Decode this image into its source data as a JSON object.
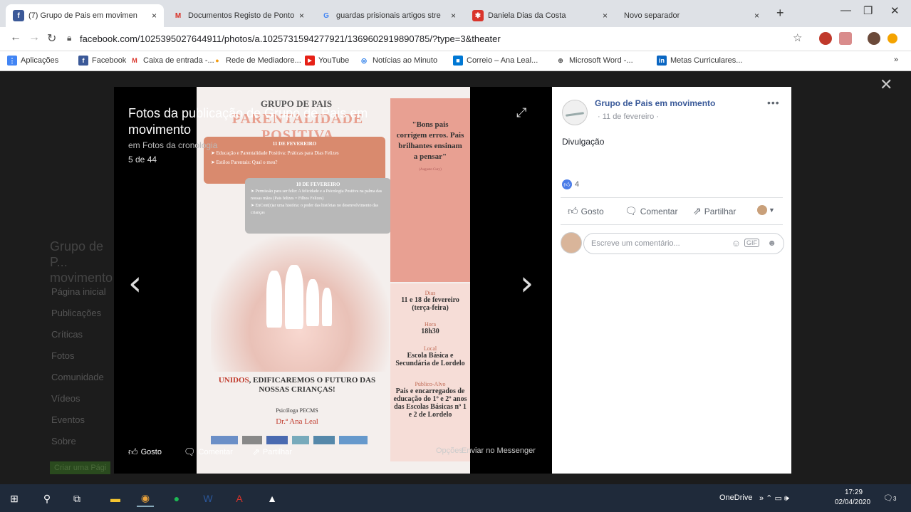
{
  "tabs": [
    {
      "label": "(7) Grupo de Pais em movimen",
      "icon": "facebook-icon",
      "color": "#3b5998",
      "glyph": "f"
    },
    {
      "label": "Documentos Registo de Ponto",
      "icon": "gmail-icon",
      "color": "#d93025",
      "glyph": "M"
    },
    {
      "label": "guardas prisionais artigos stre",
      "icon": "google-icon",
      "color": "#4285f4",
      "glyph": "G"
    },
    {
      "label": "Daniela Dias da Costa",
      "icon": "pdf-icon",
      "color": "#d9342b",
      "glyph": "✱"
    },
    {
      "label": "Novo separador",
      "icon": "",
      "color": "",
      "glyph": ""
    }
  ],
  "close_glyph": "×",
  "url": "facebook.com/1025395027644911/photos/a.1025731594277921/1369602919890785/?type=3&theater",
  "bookmarks": [
    {
      "label": "Aplicações",
      "color": "#4285f4",
      "glyph": "⋮"
    },
    {
      "label": "Facebook",
      "color": "#3b5998",
      "glyph": "f"
    },
    {
      "label": "Caixa de entrada -...",
      "color": "#d93025",
      "glyph": "M"
    },
    {
      "label": "Rede de Mediadore...",
      "color": "#f39c12",
      "glyph": "●"
    },
    {
      "label": "YouTube",
      "color": "#e62117",
      "glyph": "▶"
    },
    {
      "label": "Notícias ao Minuto",
      "color": "#1a73e8",
      "glyph": "◎"
    },
    {
      "label": "Correio – Ana Leal...",
      "color": "#0078d4",
      "glyph": "■"
    },
    {
      "label": "Microsoft Word -...",
      "color": "#555555",
      "glyph": "⊕"
    },
    {
      "label": "Metas Curriculares...",
      "color": "#0a66c2",
      "glyph": "in"
    }
  ],
  "bookmarks_more": "»",
  "background": {
    "left_title": "Grupo de P... movimento",
    "left_items": [
      "Página inicial",
      "Publicações",
      "Críticas",
      "Fotos",
      "Comunidade",
      "Vídeos",
      "Eventos",
      "Sobre"
    ],
    "left_button": "Criar uma Pági"
  },
  "viewer": {
    "title": "Fotos da publicação de Grupo de Pais em movimento",
    "subtitle": "em Fotos da cronologia",
    "count": "5 de 44",
    "like": "Gosto",
    "comment": "Comentar",
    "share": "Partilhar",
    "options": "Opções",
    "messenger": "Enviar no Messenger"
  },
  "poster": {
    "title": "GRUPO DE PAIS",
    "title2": "PARENTALIDADE POSITIVA",
    "box1_date": "11 DE FEVEREIRO",
    "box1_items": [
      "➤ Educação e Parentalidade Positiva: Práticas para Dias Felizes",
      "➤ Estilos Parentais: Qual o meu?"
    ],
    "box2_date": "18 DE FEVEREIRO",
    "box2_items": [
      "➤ Permissão para ser feliz: A felicidade e a Psicologia Positiva na palma das nossas mãos (Pais felizes = Filhos Felizes)",
      "➤ EnCont(r)ar uma história: o poder das histórias no desenvolvimento das crianças"
    ],
    "quote": "\"Bons pais corrigem erros. Pais brilhantes ensinam a pensar\"",
    "quote_author": "(Augusto Cury)",
    "dias_h": "Dias",
    "dias": "11 e 18 de fevereiro (terça-feira)",
    "hora_h": "Hora",
    "hora": "18h30",
    "local_h": "Local",
    "local": "Escola Básica e Secundária de Lordelo",
    "publico_h": "Público-Alvo",
    "publico": "Pais e encarregados de educação do 1º e 2º anos das Escolas Básicas nº 1 e 2 de Lordelo",
    "slogan_u": "UNIDOS",
    "slogan": ", EDIFICAREMOS O FUTURO DAS NOSSAS CRIANÇAS!",
    "psy": "Psicóloga PECMS",
    "dr": "Dr.ª Ana Leal"
  },
  "panel": {
    "page_name": "Grupo de Pais em movimento",
    "date": "· 11 de fevereiro ·",
    "text": "Divulgação",
    "likes": "4",
    "like": "Gosto",
    "comment": "Comentar",
    "share": "Partilhar",
    "comment_placeholder": "Escreve um comentário..."
  },
  "taskbar": {
    "onedrive": "OneDrive",
    "time": "17:29",
    "date": "02/04/2020",
    "notif": "3"
  }
}
